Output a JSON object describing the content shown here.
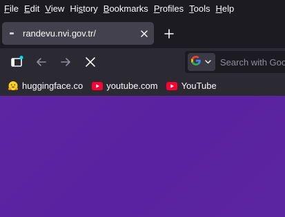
{
  "menu": {
    "items": [
      {
        "label": "File",
        "key": "F",
        "rest": "ile"
      },
      {
        "label": "Edit",
        "key": "E",
        "rest": "dit"
      },
      {
        "label": "View",
        "key": "V",
        "rest": "iew"
      },
      {
        "label": "History",
        "key": "s",
        "pre": "Hi",
        "rest": "tory"
      },
      {
        "label": "Bookmarks",
        "key": "B",
        "rest": "ookmarks"
      },
      {
        "label": "Profiles",
        "key": "P",
        "rest": "rofiles"
      },
      {
        "label": "Tools",
        "key": "T",
        "rest": "ools"
      },
      {
        "label": "Help",
        "key": "H",
        "rest": "elp"
      }
    ]
  },
  "tabs": [
    {
      "title": "randevu.nvi.gov.tr/"
    }
  ],
  "search": {
    "placeholder": "Search with Google"
  },
  "bookmarks": [
    {
      "label": "huggingface.co",
      "icon": "hugging-face-icon"
    },
    {
      "label": "youtube.com",
      "icon": "youtube-icon"
    },
    {
      "label": "YouTube",
      "icon": "youtube-icon"
    }
  ],
  "colors": {
    "page_background": "#5b23a1",
    "toolbar": "#2b2a33",
    "tab_active": "#42414d",
    "youtube_red": "#ff0033"
  }
}
